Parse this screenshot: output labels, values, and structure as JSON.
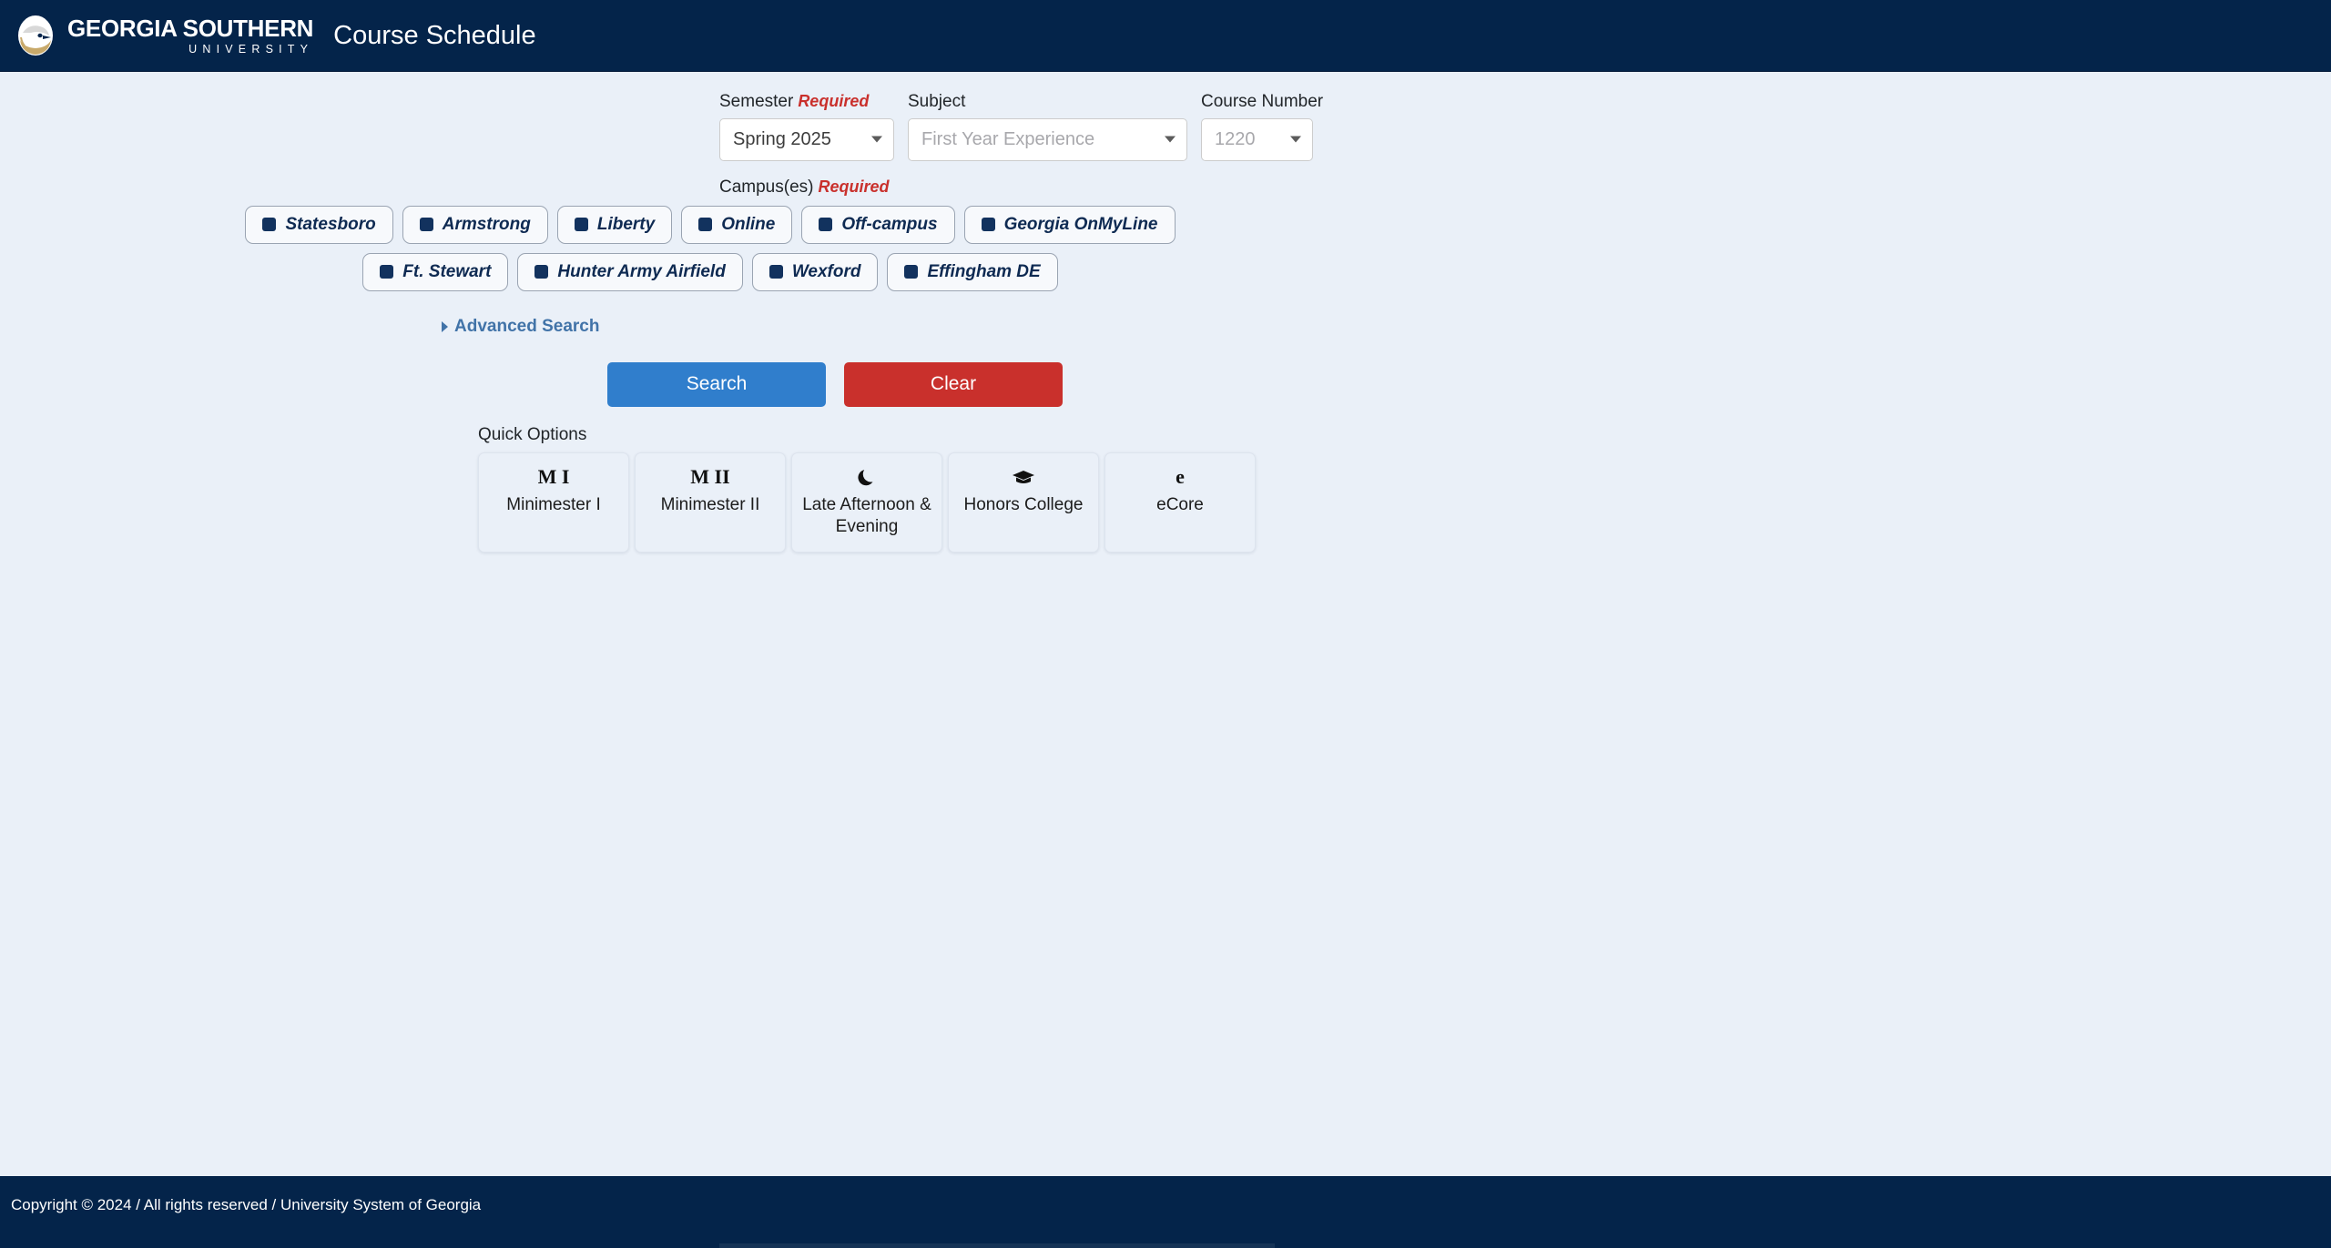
{
  "header": {
    "logo_icon": "georgia-southern-eagle-logo",
    "logo_line1": "GEORGIA SOUTHERN",
    "logo_line2": "UNIVERSITY",
    "app_title": "Course Schedule"
  },
  "form": {
    "semester": {
      "label": "Semester",
      "required_text": "Required",
      "value": "Spring 2025",
      "is_placeholder": false
    },
    "subject": {
      "label": "Subject",
      "value": "First Year Experience",
      "is_placeholder": true
    },
    "course_number": {
      "label": "Course Number",
      "value": "1220",
      "is_placeholder": true
    },
    "campus": {
      "label": "Campus(es)",
      "required_text": "Required",
      "row1": [
        {
          "label": "Statesboro"
        },
        {
          "label": "Armstrong"
        },
        {
          "label": "Liberty"
        },
        {
          "label": "Online"
        },
        {
          "label": "Off-campus"
        },
        {
          "label": "Georgia OnMyLine"
        }
      ],
      "row2": [
        {
          "label": "Ft. Stewart"
        },
        {
          "label": "Hunter Army Airfield"
        },
        {
          "label": "Wexford"
        },
        {
          "label": "Effingham DE"
        }
      ]
    },
    "advanced_search_label": "Advanced Search",
    "search_label": "Search",
    "clear_label": "Clear"
  },
  "quick_options": {
    "label": "Quick Options",
    "cards": [
      {
        "icon": "M I",
        "icon_type": "text",
        "label": "Minimester I"
      },
      {
        "icon": "M II",
        "icon_type": "text",
        "label": "Minimester II"
      },
      {
        "icon": "moon-icon",
        "icon_type": "glyph",
        "label": "Late Afternoon & Evening"
      },
      {
        "icon": "graduation-cap-icon",
        "icon_type": "glyph",
        "label": "Honors College"
      },
      {
        "icon": "e",
        "icon_type": "text",
        "label": "eCore"
      }
    ]
  },
  "footer": {
    "text": "Copyright © 2024 / All rights reserved / University System of Georgia"
  },
  "colors": {
    "header_navy": "#04244a",
    "page_background": "#eaf0f8",
    "search_blue": "#307ecc",
    "clear_red": "#c9302c",
    "required_red": "#c9302c",
    "link_blue": "#4173a8",
    "checkbox_navy": "#12325e"
  }
}
